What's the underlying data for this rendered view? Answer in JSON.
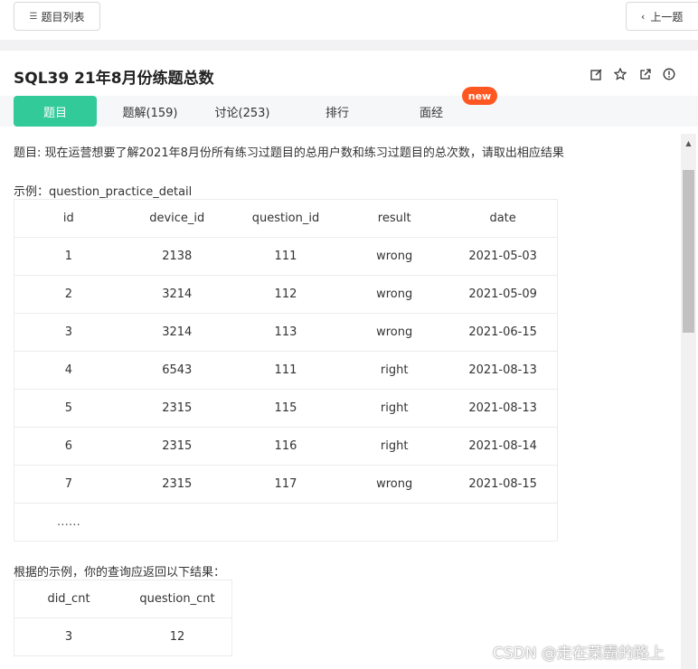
{
  "header": {
    "list_button": "题目列表",
    "prev_button": "上一题"
  },
  "problem": {
    "title": "SQL39  21年8月份练题总数"
  },
  "tabs": [
    {
      "label": "题目"
    },
    {
      "label": "题解(159)"
    },
    {
      "label": "讨论(253)"
    },
    {
      "label": "排行"
    },
    {
      "label": "面经"
    }
  ],
  "badge": "new",
  "description": "题目:  现在运营想要了解2021年8月份所有练习过题目的总用户数和练习过题目的总次数，请取出相应结果",
  "example_label": "示例：question_practice_detail",
  "sample_table": {
    "headers": [
      "id",
      "device_id",
      "question_id",
      "result",
      "date"
    ],
    "rows": [
      [
        "1",
        "2138",
        "111",
        "wrong",
        "2021-05-03"
      ],
      [
        "2",
        "3214",
        "112",
        "wrong",
        "2021-05-09"
      ],
      [
        "3",
        "3214",
        "113",
        "wrong",
        "2021-06-15"
      ],
      [
        "4",
        "6543",
        "111",
        "right",
        "2021-08-13"
      ],
      [
        "5",
        "2315",
        "115",
        "right",
        "2021-08-13"
      ],
      [
        "6",
        "2315",
        "116",
        "right",
        "2021-08-14"
      ],
      [
        "7",
        "2315",
        "117",
        "wrong",
        "2021-08-15"
      ]
    ],
    "ellipsis": "……"
  },
  "result_label": "根据的示例，你的查询应返回以下结果：",
  "result_table": {
    "headers": [
      "did_cnt",
      "question_cnt"
    ],
    "rows": [
      [
        "3",
        "12"
      ]
    ]
  },
  "watermark": "CSDN @走在菜霸的路上"
}
